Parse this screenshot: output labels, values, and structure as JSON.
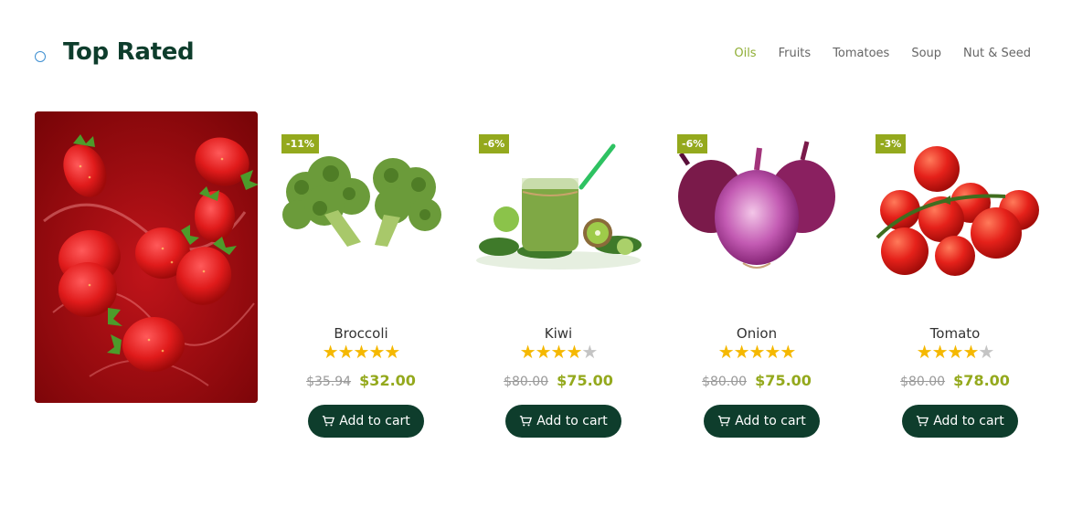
{
  "section": {
    "title": "Top Rated"
  },
  "tabs": [
    {
      "label": "Oils",
      "active": true
    },
    {
      "label": "Fruits",
      "active": false
    },
    {
      "label": "Tomatoes",
      "active": false
    },
    {
      "label": "Soup",
      "active": false
    },
    {
      "label": "Nut & Seed",
      "active": false
    }
  ],
  "products": [
    {
      "name": "Broccoli",
      "badge": "-11%",
      "old_price": "$35.94",
      "price": "$32.00",
      "rating": 5,
      "cart_label": "Add to cart",
      "image_icon": "broccoli-icon"
    },
    {
      "name": "Kiwi",
      "badge": "-6%",
      "old_price": "$80.00",
      "price": "$75.00",
      "rating": 4,
      "cart_label": "Add to cart",
      "image_icon": "kiwi-smoothie-icon"
    },
    {
      "name": "Onion",
      "badge": "-6%",
      "old_price": "$80.00",
      "price": "$75.00",
      "rating": 5,
      "cart_label": "Add to cart",
      "image_icon": "onion-icon"
    },
    {
      "name": "Tomato",
      "badge": "-3%",
      "old_price": "$80.00",
      "price": "$78.00",
      "rating": 4,
      "cart_label": "Add to cart",
      "image_icon": "tomato-icon"
    }
  ],
  "colors": {
    "brand_dark": "#0e3d2c",
    "accent": "#94a91d",
    "star": "#f5b800"
  }
}
